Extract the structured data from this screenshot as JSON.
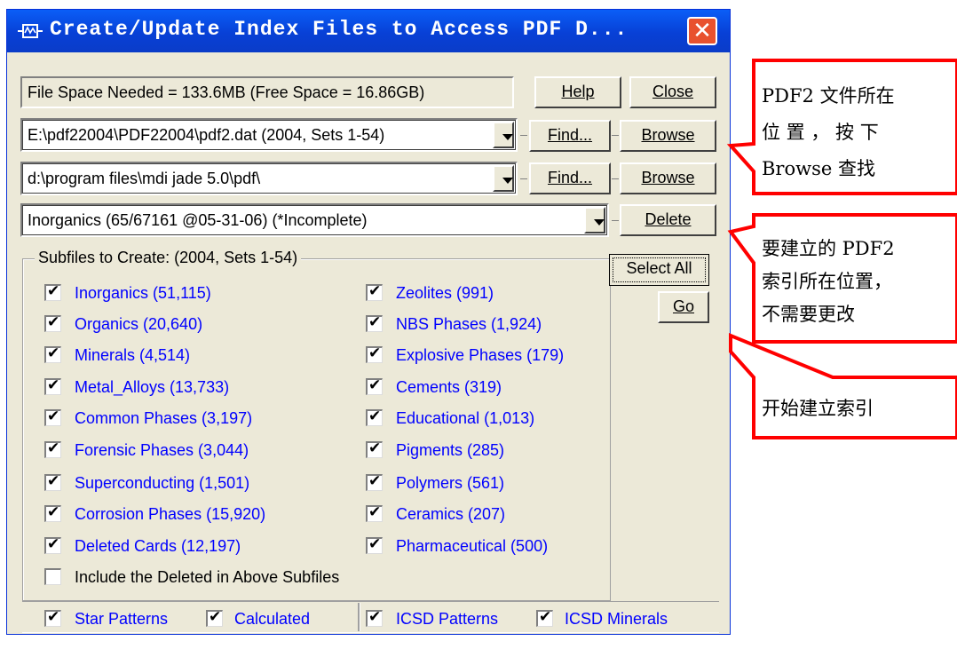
{
  "window": {
    "title": "Create/Update Index Files to Access PDF D...",
    "close_symbol": "✕"
  },
  "status_text": "File Space Needed = 133.6MB (Free Space = 16.86GB)",
  "buttons": {
    "help": "Help",
    "close": "Close",
    "find": "Find...",
    "browse": "Browse",
    "delete": "Delete",
    "select_all": "Select All",
    "go": "Go"
  },
  "fields": {
    "pdf_path": "E:\\pdf22004\\PDF22004\\pdf2.dat (2004, Sets 1-54)",
    "index_path": "d:\\program files\\mdi jade 5.0\\pdf\\",
    "subfile": "Inorganics (65/67161 @05-31-06) (*Incomplete)"
  },
  "group": {
    "legend": "Subfiles to Create: (2004, Sets 1-54)",
    "left_items": [
      "Inorganics (51,115)",
      "Organics (20,640)",
      "Minerals (4,514)",
      "Metal_Alloys (13,733)",
      "Common Phases (3,197)",
      "Forensic Phases (3,044)",
      "Superconducting (1,501)",
      "Corrosion Phases (15,920)",
      "Deleted Cards (12,197)"
    ],
    "right_items": [
      "Zeolites (991)",
      "NBS Phases (1,924)",
      "Explosive Phases (179)",
      "Cements (319)",
      "Educational (1,013)",
      "Pigments (285)",
      "Polymers (561)",
      "Ceramics (207)",
      "Pharmaceutical (500)"
    ],
    "include_deleted": "Include the Deleted in Above Subfiles"
  },
  "bottom_options": [
    "Star Patterns",
    "Calculated",
    "ICSD Patterns",
    "ICSD Minerals"
  ],
  "annotations": {
    "pdf2_location": [
      "PDF2 文件所在",
      "位 置 ， 按 下",
      "Browse 查找"
    ],
    "index_location": [
      "要建立的 PDF2",
      "索引所在位置，",
      "不需要更改"
    ],
    "start_index": "开始建立索引"
  },
  "colors": {
    "title_bar": "#0a4fe0",
    "dialog_face": "#ece9d8",
    "checkbox_label": "#0000ff",
    "annotation_border": "#ff0000"
  }
}
